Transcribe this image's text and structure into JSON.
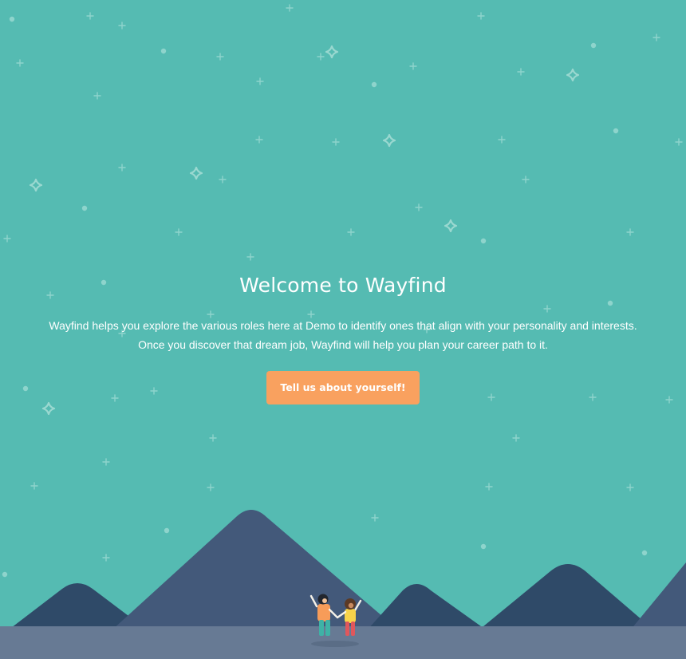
{
  "hero": {
    "title": "Welcome to Wayfind",
    "description": "Wayfind helps you explore the various roles here at Demo to identify ones that align with your personality and interests. Once you discover that dream job, Wayfind will help you plan your career path to it.",
    "cta_label": "Tell us about yourself!"
  },
  "colors": {
    "sky": "#55bbb2",
    "accent": "#f9a15f",
    "mountain_main": "#43597a",
    "mountain_dark": "#2f4a68",
    "ground": "#677a94"
  }
}
